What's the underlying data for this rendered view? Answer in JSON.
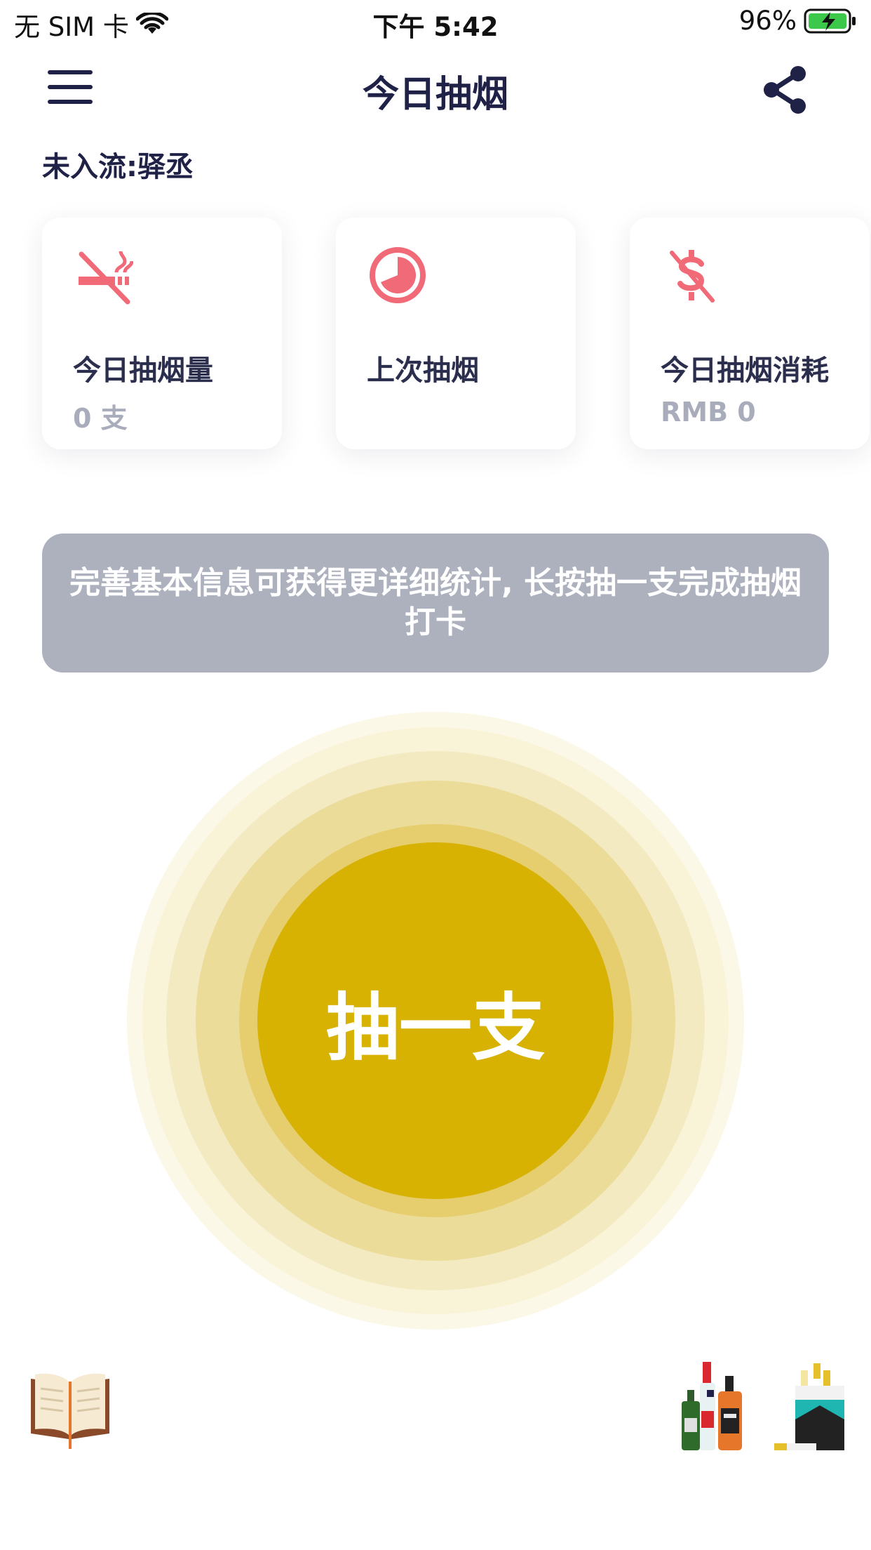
{
  "status_bar": {
    "carrier": "无 SIM 卡",
    "time": "下午 5:42",
    "battery": "96%"
  },
  "header": {
    "title": "今日抽烟",
    "menu_icon": "hamburger-menu-icon",
    "share_icon": "share-icon"
  },
  "subtitle": "未入流:驿丞",
  "stats": [
    {
      "icon": "no-smoking-icon",
      "label": "今日抽烟量",
      "value": "0 支"
    },
    {
      "icon": "clock-pie-icon",
      "label": "上次抽烟",
      "value": ""
    },
    {
      "icon": "dollar-slash-icon",
      "label": "今日抽烟消耗",
      "value": "RMB 0"
    }
  ],
  "hint": "完善基本信息可获得更详细统计, 长按抽一支完成抽烟打卡",
  "smoke_button": {
    "label": "抽一支"
  },
  "bottom_icons": [
    "book-icon",
    "liquor-bottles-icon",
    "cigarette-pack-icon"
  ],
  "colors": {
    "accent": "#d7b202",
    "icon_red": "#f06a78",
    "text_dark": "#1f2147",
    "hint_bg": "#adb1be",
    "battery_green": "#3cc84a"
  }
}
